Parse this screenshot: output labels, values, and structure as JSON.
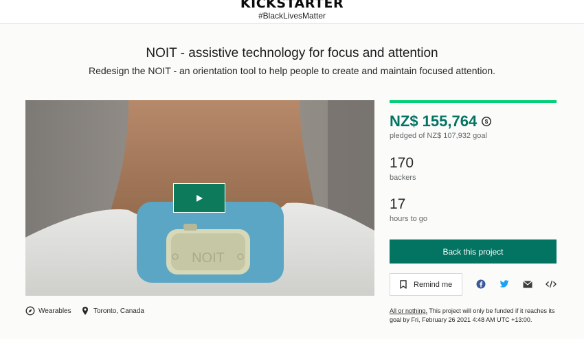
{
  "header": {
    "logo": "KICKSTARTER",
    "hashtag": "#BlackLivesMatter"
  },
  "project": {
    "title": "NOIT - assistive technology for focus and attention",
    "subtitle": "Redesign the NOIT - an orientation tool to help people to create and maintain focused attention.",
    "video_label": "NOIT",
    "category": "Wearables",
    "location": "Toronto, Canada"
  },
  "stats": {
    "pledged": "NZ$ 155,764",
    "goal_text": "pledged of NZ$ 107,932 goal",
    "backers_count": "170",
    "backers_label": "backers",
    "hours_count": "17",
    "hours_label": "hours to go"
  },
  "actions": {
    "back_label": "Back this project",
    "remind_label": "Remind me"
  },
  "funding_note": {
    "link_text": "All or nothing.",
    "text": " This project will only be funded if it reaches its goal by Fri, February 26 2021 4:48 AM UTC +13:00."
  },
  "colors": {
    "brand_green": "#037362",
    "accent_green": "#05ce78",
    "play_button": "#0e7a5c",
    "facebook": "#3b5998",
    "twitter": "#1da1f2"
  },
  "icons": {
    "category": "compass-icon",
    "location": "location-pin-icon",
    "currency": "currency-refresh-icon",
    "remind": "bookmark-icon",
    "share": [
      "facebook-icon",
      "twitter-icon",
      "email-icon",
      "embed-code-icon"
    ]
  }
}
